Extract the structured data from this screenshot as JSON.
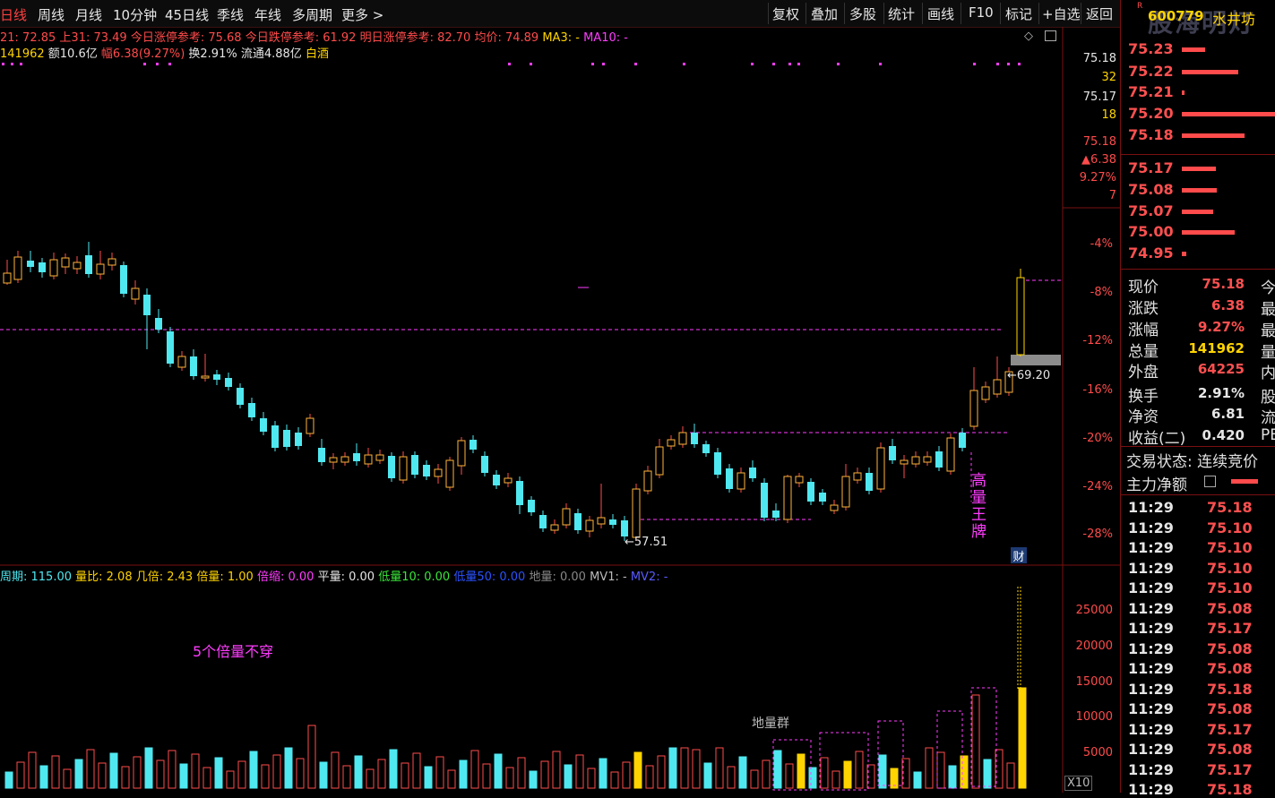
{
  "toolbar": {
    "tabs": [
      "日线",
      "周线",
      "月线",
      "10分钟",
      "45日线",
      "季线",
      "年线",
      "多周期",
      "更多 >"
    ],
    "buttons": [
      "复权",
      "叠加",
      "多股",
      "统计",
      "画线",
      "F10",
      "标记",
      "+自选",
      "返回"
    ]
  },
  "info_line1": {
    "prev_close": "21: 72.85",
    "upper": "上31: 73.49",
    "limit_up": "今日涨停参考: 75.68",
    "limit_down": "今日跌停参考: 61.92",
    "next_limit": "明日涨停参考: 82.70",
    "avg": "均价: 74.89",
    "ma3": "MA3: -",
    "ma10": "MA10: -"
  },
  "info_line2": {
    "volume": "141962",
    "amount": "额10.6亿",
    "range": "幅6.38(9.27%)",
    "turnover": "换2.91%",
    "float": "流通4.88亿",
    "sector": "白酒"
  },
  "price_axis": [
    "-4%",
    "-8%",
    "-12%",
    "-16%",
    "-20%",
    "-24%",
    "-28%"
  ],
  "top_axis": [
    "75.18",
    "32",
    "75.17",
    "18",
    "75.18",
    "▲6.38",
    "9.27%",
    "7"
  ],
  "annotations": {
    "low_price": "57.51",
    "mark_price": "69.20",
    "high_vol_king": "高量王牌",
    "cai": "财",
    "five_times": "5个倍量不穿",
    "di_liang_qun": "地量群",
    "x10": "X10"
  },
  "volume_info": {
    "period": "周期: 115.00",
    "ratio": "量比: 2.08",
    "jibei": "几倍: 2.43",
    "beiliang": "倍量: 1.00",
    "beisuo": "倍缩: 0.00",
    "pingliang": "平量: 0.00",
    "diliang10": "低量10: 0.00",
    "diliang50": "低量50: 0.00",
    "diliang": "地量: 0.00",
    "mv1": "MV1: -",
    "mv2": "MV2: -"
  },
  "volume_axis": [
    "25000",
    "20000",
    "15000",
    "10000",
    "5000"
  ],
  "stock": {
    "code": "600779",
    "name": "水井坊",
    "watermark": "股海明灯"
  },
  "order_book": [
    {
      "price": "75.23",
      "bar": 0.25
    },
    {
      "price": "75.22",
      "bar": 0.6
    },
    {
      "price": "75.21",
      "bar": 0.03
    },
    {
      "price": "75.20",
      "bar": 1.0
    },
    {
      "price": "75.18",
      "bar": 0.67
    },
    {
      "price": "75.17",
      "bar": 0.36
    },
    {
      "price": "75.08",
      "bar": 0.37
    },
    {
      "price": "75.07",
      "bar": 0.33
    },
    {
      "price": "75.00",
      "bar": 0.56
    },
    {
      "price": "74.95",
      "bar": 0.05
    }
  ],
  "quote": [
    {
      "label": "现价",
      "value": "75.18",
      "color": "#ff5050",
      "cut": "今"
    },
    {
      "label": "涨跌",
      "value": "6.38",
      "color": "#ff5050",
      "cut": "最"
    },
    {
      "label": "涨幅",
      "value": "9.27%",
      "color": "#ff5050",
      "cut": "最"
    },
    {
      "label": "总量",
      "value": "141962",
      "color": "#ffd400",
      "cut": "量"
    },
    {
      "label": "外盘",
      "value": "64225",
      "color": "#ff5050",
      "cut": "内"
    },
    {
      "label": "换手",
      "value": "2.91%",
      "color": "#e6e6e6",
      "cut": "股"
    },
    {
      "label": "净资",
      "value": "6.81",
      "color": "#e6e6e6",
      "cut": "流"
    },
    {
      "label": "收益(二)",
      "value": "0.420",
      "color": "#e6e6e6",
      "cut": "PE"
    }
  ],
  "status": {
    "label": "交易状态: 连续竞价",
    "main_net": "主力净额"
  },
  "ticks": [
    {
      "t": "11:29",
      "p": "75.18"
    },
    {
      "t": "11:29",
      "p": "75.10"
    },
    {
      "t": "11:29",
      "p": "75.10"
    },
    {
      "t": "11:29",
      "p": "75.10"
    },
    {
      "t": "11:29",
      "p": "75.10"
    },
    {
      "t": "11:29",
      "p": "75.08"
    },
    {
      "t": "11:29",
      "p": "75.17"
    },
    {
      "t": "11:29",
      "p": "75.08"
    },
    {
      "t": "11:29",
      "p": "75.08"
    },
    {
      "t": "11:29",
      "p": "75.18"
    },
    {
      "t": "11:29",
      "p": "75.08"
    },
    {
      "t": "11:29",
      "p": "75.17"
    },
    {
      "t": "11:29",
      "p": "75.08"
    },
    {
      "t": "11:29",
      "p": "75.17"
    },
    {
      "t": "11:29",
      "p": "75.18"
    }
  ],
  "colors": {
    "up": "#ff4b4b",
    "down": "#4fe8f0",
    "accent": "#ff3cff",
    "yellow": "#ffd400"
  }
}
